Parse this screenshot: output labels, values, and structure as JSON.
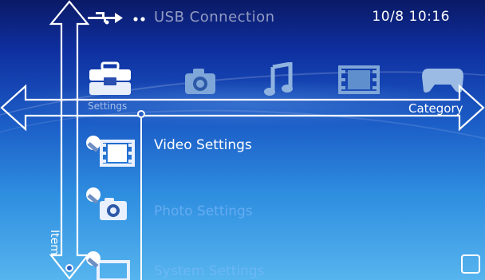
{
  "status_bar": {
    "usb_label": "USB Connection",
    "clock": "10/8 10:16",
    "usb_icon": "usb-icon"
  },
  "categories": [
    {
      "name": "Settings",
      "icon": "toolbox-icon",
      "selected": true
    },
    {
      "name": "",
      "icon": "camera-icon",
      "selected": false
    },
    {
      "name": "",
      "icon": "music-note-icon",
      "selected": false
    },
    {
      "name": "",
      "icon": "film-icon",
      "selected": false
    },
    {
      "name": "",
      "icon": "gamepad-icon",
      "selected": false
    }
  ],
  "items": [
    {
      "label": "Video Settings",
      "icon": "video-settings-icon",
      "selected": true
    },
    {
      "label": "Photo Settings",
      "icon": "photo-settings-icon",
      "selected": false
    },
    {
      "label": "System Settings",
      "icon": "system-settings-icon",
      "selected": false
    }
  ],
  "annotations": {
    "category_caption": "Category",
    "item_caption": "Item"
  },
  "colors": {
    "background_top": "#0a1a66",
    "background_bottom": "#56b4ee",
    "annotation_arrow": "#ffffff"
  },
  "corner_button_icon": "square-button-icon"
}
